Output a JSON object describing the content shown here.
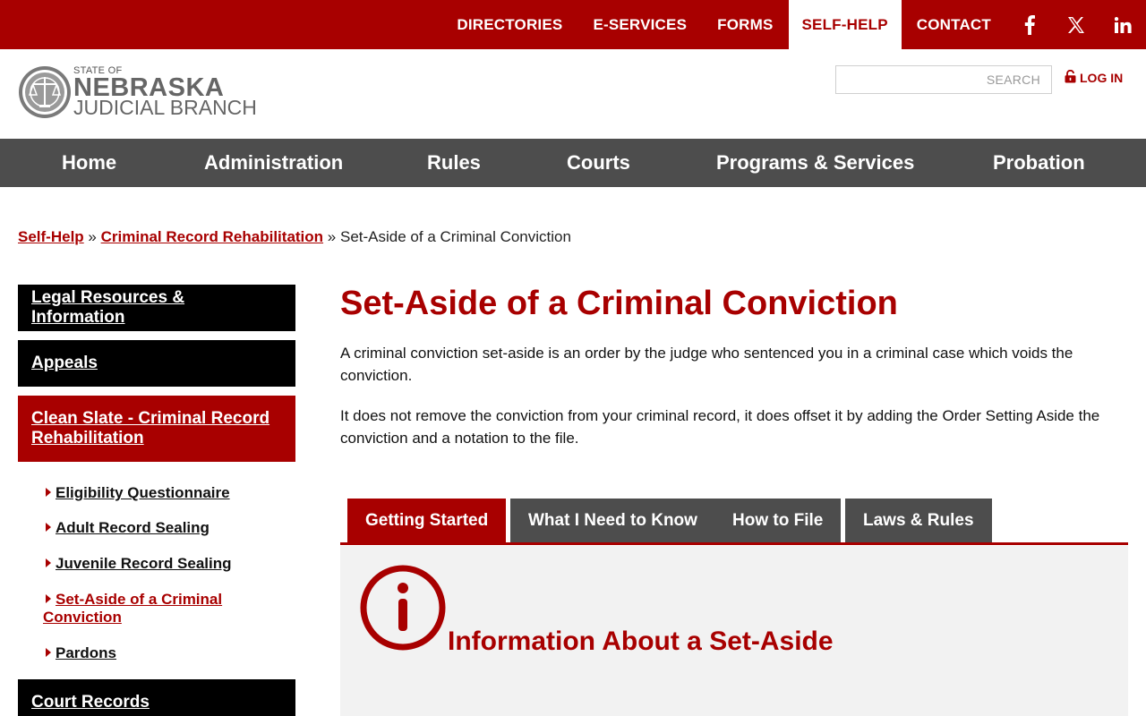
{
  "top_nav": {
    "items": [
      {
        "label": "DIRECTORIES",
        "active": false
      },
      {
        "label": "E-SERVICES",
        "active": false
      },
      {
        "label": "FORMS",
        "active": false
      },
      {
        "label": "SELF-HELP",
        "active": true
      },
      {
        "label": "CONTACT",
        "active": false
      }
    ],
    "social_icons": [
      "facebook-icon",
      "x-icon",
      "linkedin-icon"
    ]
  },
  "header": {
    "logo": {
      "small": "STATE OF",
      "big": "NEBRASKA",
      "sub": "JUDICIAL BRANCH"
    },
    "search": {
      "placeholder": "SEARCH",
      "value": ""
    },
    "login_label": "LOG IN"
  },
  "main_nav": {
    "items": [
      "Home",
      "Administration",
      "Rules",
      "Courts",
      "Programs & Services",
      "Probation"
    ]
  },
  "breadcrumb": {
    "items": [
      "Self-Help",
      "Criminal Record Rehabilitation",
      "Set-Aside of a Criminal Conviction"
    ],
    "separator": "»"
  },
  "sidebar": {
    "sections": [
      {
        "label": "Legal Resources & Information",
        "active": false
      },
      {
        "label": "Appeals",
        "active": false
      },
      {
        "label": "Clean Slate - Criminal Record Rehabilitation",
        "active": true
      }
    ],
    "subitems": [
      {
        "label": "Eligibility Questionnaire",
        "current": false
      },
      {
        "label": "Adult Record Sealing",
        "current": false
      },
      {
        "label": "Juvenile Record Sealing",
        "current": false
      },
      {
        "label": "Set-Aside of a Criminal Conviction",
        "current": true
      },
      {
        "label": "Pardons",
        "current": false
      }
    ],
    "after_section": "Court Records"
  },
  "content": {
    "title": "Set-Aside of a Criminal Conviction",
    "paragraphs": [
      "A criminal conviction set-aside is an order by the judge who sentenced you in a criminal case which voids the conviction.",
      "It does not remove the conviction from your criminal record, it does offset it by adding the Order Setting Aside the conviction and a notation to the file."
    ],
    "tabs": [
      {
        "label": "Getting Started",
        "active": true
      },
      {
        "label": "What I Need to Know",
        "active": false
      },
      {
        "label": "How to File",
        "active": false
      },
      {
        "label": "Laws & Rules",
        "active": false
      }
    ],
    "panel": {
      "icon": "info-icon",
      "heading": "Information About a Set-Aside"
    }
  },
  "colors": {
    "brand_red": "#a80000",
    "nav_gray": "#4d4d4d",
    "panel_bg": "#f2f2f2",
    "sidebar_black": "#000000"
  }
}
